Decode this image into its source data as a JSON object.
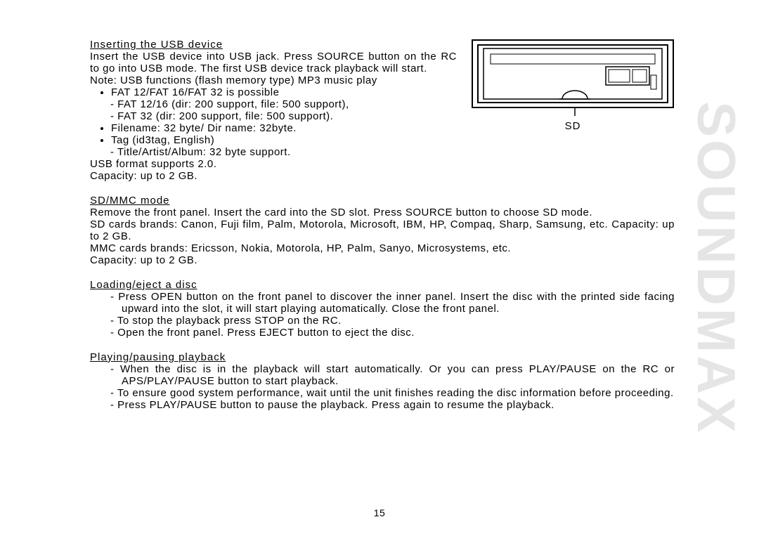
{
  "watermark": "SOUNDMAX",
  "page_number": "15",
  "sd_label": "SD",
  "sections": {
    "usb": {
      "title": "Inserting the USB device",
      "intro": "Insert the USB device into USB jack. Press SOURCE button on the RC to go into USB mode. The first USB device track playback will start.",
      "note": "Note: USB functions (flash memory type) MP3 music play",
      "b1": "FAT 12/FAT 16/FAT 32 is possible",
      "d1": "FAT 12/16 (dir: 200 support, file: 500 support),",
      "d2": "FAT 32 (dir: 200 support, file: 500 support).",
      "b2": "Filename: 32 byte/ Dir name: 32byte.",
      "b3": "Tag (id3tag, English)",
      "d3": "Title/Artist/Album: 32 byte support.",
      "outro1": "USB format supports 2.0.",
      "outro2": "Capacity: up to 2 GB."
    },
    "sd": {
      "title": "SD/MMC mode",
      "p1": "Remove the front panel. Insert the card into the SD slot. Press SOURCE button to choose SD mode.",
      "p2": "SD cards brands: Canon, Fuji film, Palm, Motorola, Microsoft, IBM, HP, Compaq, Sharp, Samsung, etc. Capacity: up to 2 GB.",
      "p3": "MMC cards brands: Ericsson, Nokia, Motorola, HP, Palm, Sanyo, Microsystems, etc.",
      "p4": "Capacity: up to 2 GB."
    },
    "load": {
      "title": "Loading/eject a disc",
      "d1": "Press OPEN button on the front panel to discover the inner panel. Insert the disc with the printed side facing upward into the slot, it will start playing automatically. Close the front panel.",
      "d2": "To stop the playback press STOP on the RC.",
      "d3": "Open the front panel. Press EJECT button to eject the disc."
    },
    "play": {
      "title": "Playing/pausing playback",
      "d1": "When the disc is in the playback will start automatically. Or you can press PLAY/PAUSE on the RC or APS/PLAY/PAUSE button to start playback.",
      "d2": "To ensure good system performance, wait until the unit finishes reading the disc information before proceeding.",
      "d3": "Press PLAY/PAUSE button to pause the playback. Press again to resume the playback."
    }
  }
}
